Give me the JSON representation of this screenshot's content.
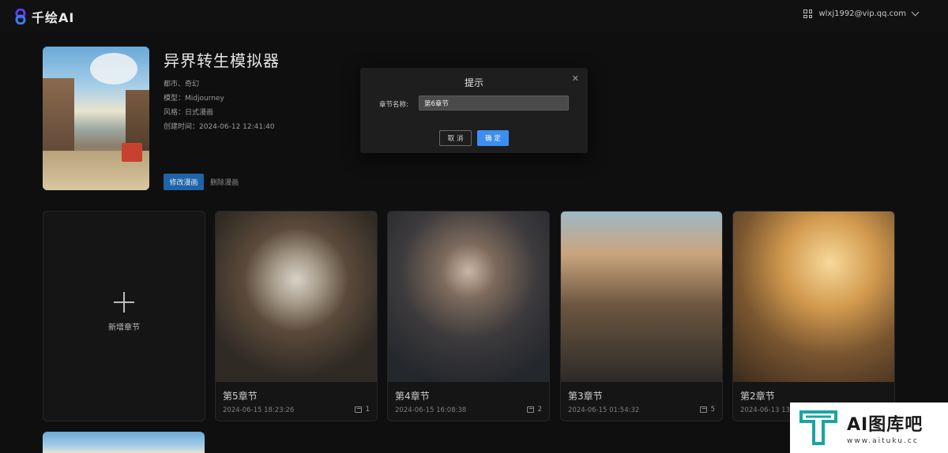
{
  "app": {
    "logo_text": "千绘AI",
    "brand_color": "#5b3df0"
  },
  "header": {
    "user_email": "wlxj1992@vip.qq.com"
  },
  "comic": {
    "title": "异界转生模拟器",
    "tags": "都市、奇幻",
    "model": "模型：Midjourney",
    "style": "风格：日式漫画",
    "created": "创建时间：2024-06-12 12:41:40",
    "edit_label": "修改漫画",
    "delete_label": "删除漫画"
  },
  "new_chapter_label": "新增章节",
  "chapters": [
    {
      "title": "第5章节",
      "date": "2024-06-15 18:23:26",
      "count": "1"
    },
    {
      "title": "第4章节",
      "date": "2024-06-15 16:08:38",
      "count": "2"
    },
    {
      "title": "第3章节",
      "date": "2024-06-15 01:54:32",
      "count": "5"
    },
    {
      "title": "第2章节",
      "date": "2024-06-13 13:",
      "count": ""
    }
  ],
  "dialog": {
    "title": "提示",
    "field_label": "章节名称:",
    "field_value": "第6章节",
    "cancel_label": "取 消",
    "confirm_label": "确 定",
    "accent": "#3d8ef0"
  },
  "watermark": {
    "title": "AI图库吧",
    "url": "www.aituku.cc",
    "color": "#1aa5a0"
  }
}
